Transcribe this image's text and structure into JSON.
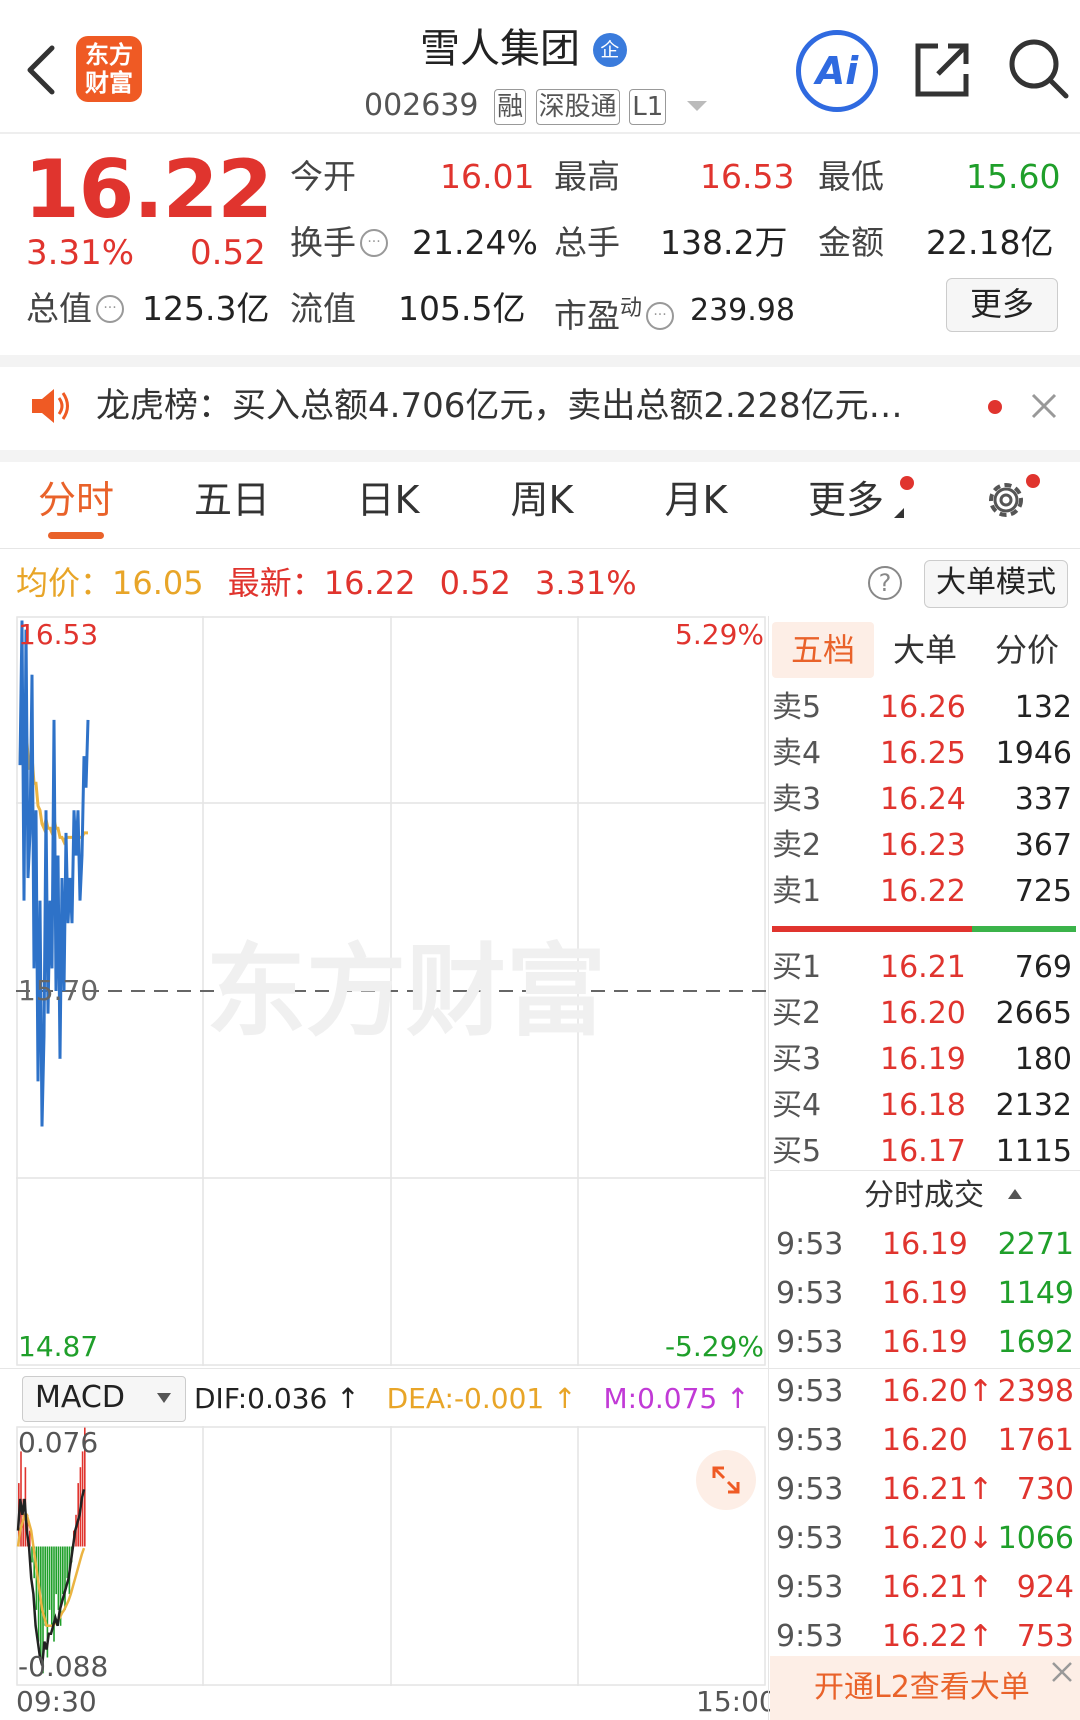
{
  "header": {
    "logo_line1": "东方",
    "logo_line2": "财富",
    "title": "雪人集团",
    "title_badge": "企",
    "code": "002639",
    "tags": [
      "融",
      "深股通",
      "L1"
    ],
    "ai_label": "Ai"
  },
  "quote": {
    "price": "16.22",
    "change_pct": "3.31%",
    "change": "0.52",
    "open_label": "今开",
    "open": "16.01",
    "high_label": "最高",
    "high": "16.53",
    "low_label": "最低",
    "low": "15.60",
    "turnover_label": "换手",
    "turnover": "21.24%",
    "volume_label": "总手",
    "volume": "138.2万",
    "amount_label": "金额",
    "amount": "22.18亿",
    "mktcap_label": "总值",
    "mktcap": "125.3亿",
    "float_label": "流值",
    "float_cap": "105.5亿",
    "pe_label": "市盈",
    "pe_sup": "动",
    "pe": "239.98",
    "more_button": "更多"
  },
  "notice": {
    "text": "龙虎榜：买入总额4.706亿元，卖出总额2.228亿元…"
  },
  "tabs": [
    {
      "label": "分时",
      "active": true
    },
    {
      "label": "五日"
    },
    {
      "label": "日K"
    },
    {
      "label": "周K"
    },
    {
      "label": "月K"
    },
    {
      "label": "更多"
    }
  ],
  "chart_info": {
    "avg_label": "均价：",
    "avg": "16.05",
    "latest_label": "最新：",
    "latest": "16.22",
    "latest_change": "0.52",
    "latest_pct": "3.31%",
    "help_icon_text": "?",
    "big_order_button": "大单模式"
  },
  "watermark": "东方财富",
  "chart_data": {
    "type": "line",
    "y_top_label": "16.53",
    "y_mid_label": "15.70",
    "y_bottom_label": "14.87",
    "pct_top_label": "5.29%",
    "pct_bottom_label": "-5.29%",
    "x_start_label": "09:30",
    "x_end_label": "15:00",
    "ylim": [
      14.87,
      16.53
    ],
    "prev_close": 15.7,
    "series": [
      {
        "values": [
          16.2,
          16.52,
          15.9,
          16.5,
          15.95,
          16.05,
          16.4,
          15.75,
          16.1,
          15.5,
          15.9,
          15.4,
          15.6,
          16.1,
          15.65,
          15.9,
          15.75,
          16.3,
          15.7,
          16.0,
          15.55,
          15.95,
          15.7,
          16.05,
          15.85,
          15.95,
          15.85,
          16.1,
          16.0,
          16.1,
          15.9,
          16.0,
          16.22,
          16.15,
          16.3
        ]
      },
      {
        "values": [
          16.2,
          16.36,
          16.21,
          16.28,
          16.22,
          16.19,
          16.22,
          16.16,
          16.16,
          16.11,
          16.1,
          16.07,
          16.06,
          16.08,
          16.06,
          16.06,
          16.05,
          16.08,
          16.06,
          16.06,
          16.04,
          16.04,
          16.03,
          16.04,
          16.04,
          16.04,
          16.04,
          16.04,
          16.04,
          16.04,
          16.04,
          16.04,
          16.05,
          16.05,
          16.05
        ]
      }
    ],
    "grid": true
  },
  "macd": {
    "selector": "MACD",
    "dif_label": "DIF:0.036 ↑",
    "dea_label": "DEA:-0.001 ↑",
    "m_label": "M:0.075 ↑",
    "top_label": "0.076",
    "bottom_label": "-0.088",
    "ylim": [
      -0.088,
      0.076
    ],
    "hist": [
      0.04,
      0.06,
      0.03,
      0.05,
      0.02,
      0.01,
      -0.01,
      -0.02,
      -0.04,
      -0.06,
      -0.07,
      -0.08,
      -0.05,
      -0.07,
      -0.04,
      -0.05,
      -0.06,
      -0.03,
      -0.04,
      -0.05,
      -0.03,
      -0.04,
      -0.02,
      -0.03,
      -0.01,
      0.01,
      0.02,
      0.04,
      0.05,
      0.06,
      0.075
    ],
    "dif": [
      0.01,
      0.03,
      0.02,
      0.03,
      0.01,
      0.0,
      -0.02,
      -0.03,
      -0.05,
      -0.06,
      -0.07,
      -0.075,
      -0.06,
      -0.065,
      -0.055,
      -0.055,
      -0.05,
      -0.045,
      -0.05,
      -0.04,
      -0.035,
      -0.03,
      -0.025,
      -0.02,
      -0.01,
      0.0,
      0.01,
      0.015,
      0.02,
      0.03,
      0.036
    ],
    "dea": [
      0.0,
      0.01,
      0.015,
      0.02,
      0.02,
      0.015,
      0.01,
      0.0,
      -0.01,
      -0.02,
      -0.03,
      -0.04,
      -0.045,
      -0.05,
      -0.05,
      -0.05,
      -0.05,
      -0.048,
      -0.047,
      -0.045,
      -0.042,
      -0.04,
      -0.037,
      -0.034,
      -0.03,
      -0.025,
      -0.02,
      -0.015,
      -0.01,
      -0.005,
      -0.001
    ]
  },
  "orderbook": {
    "tabs": [
      "五档",
      "大单",
      "分价"
    ],
    "asks": [
      {
        "label": "卖5",
        "price": "16.26",
        "vol": "132"
      },
      {
        "label": "卖4",
        "price": "16.25",
        "vol": "1946"
      },
      {
        "label": "卖3",
        "price": "16.24",
        "vol": "337"
      },
      {
        "label": "卖2",
        "price": "16.23",
        "vol": "367"
      },
      {
        "label": "卖1",
        "price": "16.22",
        "vol": "725"
      }
    ],
    "bids": [
      {
        "label": "买1",
        "price": "16.21",
        "vol": "769"
      },
      {
        "label": "买2",
        "price": "16.20",
        "vol": "2665"
      },
      {
        "label": "买3",
        "price": "16.19",
        "vol": "180"
      },
      {
        "label": "买4",
        "price": "16.18",
        "vol": "2132"
      },
      {
        "label": "买5",
        "price": "16.17",
        "vol": "1115"
      }
    ]
  },
  "trades": {
    "header": "分时成交",
    "rows": [
      {
        "time": "9:53",
        "price": "16.19",
        "vol": "2271",
        "color": "#1f9f2a"
      },
      {
        "time": "9:53",
        "price": "16.19",
        "vol": "1149",
        "color": "#1f9f2a"
      },
      {
        "time": "9:53",
        "price": "16.19",
        "vol": "1692",
        "color": "#1f9f2a"
      },
      {
        "time": "9:53",
        "price": "16.20↑",
        "vol": "2398",
        "color": "#e0342e"
      },
      {
        "time": "9:53",
        "price": "16.20",
        "vol": "1761",
        "color": "#e0342e"
      },
      {
        "time": "9:53",
        "price": "16.21↑",
        "vol": "730",
        "color": "#e0342e"
      },
      {
        "time": "9:53",
        "price": "16.20↓",
        "vol": "1066",
        "color": "#1f9f2a"
      },
      {
        "time": "9:53",
        "price": "16.21↑",
        "vol": "924",
        "color": "#e0342e"
      },
      {
        "time": "9:53",
        "price": "16.22↑",
        "vol": "753",
        "color": "#e0342e"
      }
    ],
    "upsell": "开通L2查看大单"
  }
}
